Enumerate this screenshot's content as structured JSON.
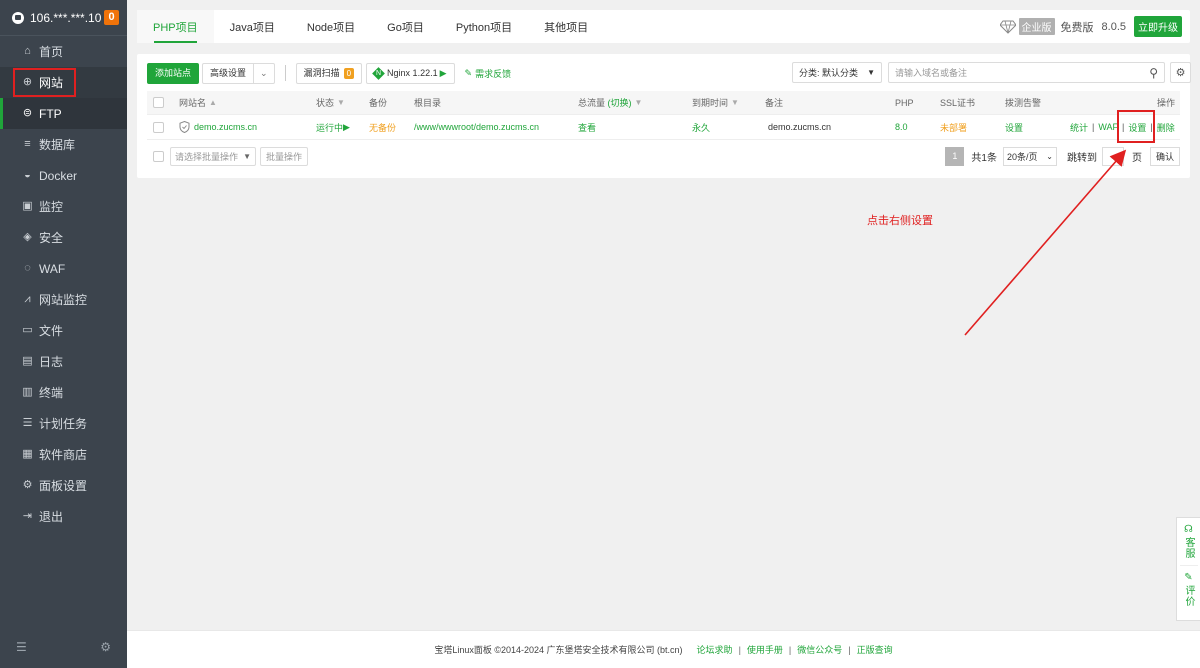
{
  "sidebar": {
    "server_ip": "106.***.***.10",
    "badge_count": "0",
    "items": [
      {
        "label": "首页",
        "icon": "home-icon"
      },
      {
        "label": "网站",
        "icon": "globe-icon"
      },
      {
        "label": "FTP",
        "icon": "ftp-icon"
      },
      {
        "label": "数据库",
        "icon": "database-icon"
      },
      {
        "label": "Docker",
        "icon": "docker-icon"
      },
      {
        "label": "监控",
        "icon": "monitor-icon"
      },
      {
        "label": "安全",
        "icon": "shield-icon"
      },
      {
        "label": "WAF",
        "icon": "waf-icon"
      },
      {
        "label": "网站监控",
        "icon": "chart-icon"
      },
      {
        "label": "文件",
        "icon": "folder-icon"
      },
      {
        "label": "日志",
        "icon": "log-icon"
      },
      {
        "label": "终端",
        "icon": "terminal-icon"
      },
      {
        "label": "计划任务",
        "icon": "task-icon"
      },
      {
        "label": "软件商店",
        "icon": "store-icon"
      },
      {
        "label": "面板设置",
        "icon": "settings-icon"
      },
      {
        "label": "退出",
        "icon": "logout-icon"
      }
    ]
  },
  "tabs": [
    "PHP项目",
    "Java项目",
    "Node项目",
    "Go项目",
    "Python项目",
    "其他项目"
  ],
  "header_right": {
    "edition": "企业版",
    "free": "免费版",
    "version": "8.0.5",
    "upgrade": "立即升级"
  },
  "toolbar": {
    "add_site": "添加站点",
    "advanced": "高级设置",
    "vuln_scan": "漏洞扫描",
    "vuln_count": "0",
    "nginx": "Nginx 1.22.1",
    "feedback": "需求反馈",
    "category": "分类: 默认分类",
    "search_placeholder": "请输入域名或备注"
  },
  "table": {
    "headers": {
      "name": "网站名",
      "status": "状态",
      "backup": "备份",
      "root": "根目录",
      "traffic": "总流量",
      "traffic_switch": "(切换)",
      "expire": "到期时间",
      "note": "备注",
      "php": "PHP",
      "ssl": "SSL证书",
      "alert": "拨测告警",
      "ops": "操作"
    },
    "rows": [
      {
        "name": "demo.zucms.cn",
        "status": "运行中",
        "backup": "无备份",
        "root": "/www/wwwroot/demo.zucms.cn",
        "traffic": "查看",
        "expire": "永久",
        "note": "demo.zucms.cn",
        "php": "8.0",
        "ssl": "未部署",
        "alert": "设置",
        "act_stats": "统计",
        "act_waf": "WAF",
        "act_settings": "设置",
        "act_delete": "删除"
      }
    ]
  },
  "batch": {
    "select_placeholder": "请选择批量操作",
    "button": "批量操作"
  },
  "pager": {
    "current": "1",
    "total": "共1条",
    "page_size": "20条/页",
    "jump": "跳转到",
    "unit": "页",
    "confirm": "确认"
  },
  "annotation": {
    "text": "点击右侧设置",
    "color": "#e02020"
  },
  "footer": {
    "copyright": "宝塔Linux面板 ©2014-2024 广东堡塔安全技术有限公司 (bt.cn)",
    "links": [
      "论坛求助",
      "使用手册",
      "微信公众号",
      "正版查询"
    ]
  },
  "float_panel": {
    "service": "客服",
    "review": "评价"
  },
  "colors": {
    "accent": "#20a53a",
    "sidebar_bg": "#3c444d",
    "warning": "#f0a020"
  }
}
